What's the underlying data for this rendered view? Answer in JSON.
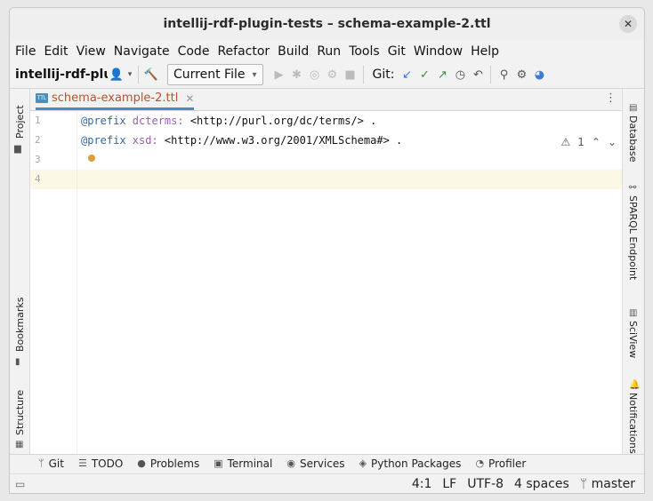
{
  "window": {
    "title": "intellij-rdf-plugin-tests – schema-example-2.ttl"
  },
  "menu": [
    "File",
    "Edit",
    "View",
    "Navigate",
    "Code",
    "Refactor",
    "Build",
    "Run",
    "Tools",
    "Git",
    "Window",
    "Help"
  ],
  "toolbar": {
    "project_name": "intellij-rdf-plugin-tests",
    "run_config": "Current File",
    "git_label": "Git:"
  },
  "left_tools": {
    "project": "Project",
    "bookmarks": "Bookmarks",
    "structure": "Structure"
  },
  "right_tools": {
    "database": "Database",
    "sparql": "SPARQL Endpoint",
    "sciview": "SciView",
    "notifications": "Notifications"
  },
  "editor": {
    "tab_label": "schema-example-2.ttl",
    "file_badge": "TTL",
    "inspection_count": "1",
    "lines": [
      {
        "num": "1",
        "kw": "@prefix",
        "pfx": " dcterms:",
        "uri": " <http://purl.org/dc/terms/> ."
      },
      {
        "num": "2",
        "kw": "@prefix",
        "pfx": " xsd:",
        "uri": " <http://www.w3.org/2001/XMLSchema#> ."
      },
      {
        "num": "3",
        "kw": "",
        "pfx": "",
        "uri": ""
      },
      {
        "num": "4",
        "kw": "",
        "pfx": "",
        "uri": ""
      }
    ]
  },
  "bottom_tools": [
    "Git",
    "TODO",
    "Problems",
    "Terminal",
    "Services",
    "Python Packages",
    "Profiler"
  ],
  "status": {
    "position": "4:1",
    "line_sep": "LF",
    "encoding": "UTF-8",
    "indent": "4 spaces",
    "branch": "master"
  }
}
